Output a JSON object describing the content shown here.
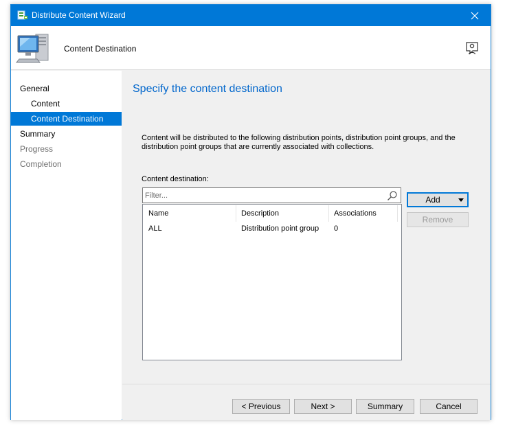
{
  "window": {
    "title": "Distribute Content Wizard",
    "accent_color": "#0078d7"
  },
  "header": {
    "title": "Content Destination",
    "icon": "computer-icon",
    "help_icon": "help-icon"
  },
  "nav": {
    "items": [
      {
        "label": "General",
        "state": "normal"
      },
      {
        "label": "Content",
        "state": "normal"
      },
      {
        "label": "Content Destination",
        "state": "active"
      },
      {
        "label": "Summary",
        "state": "normal"
      },
      {
        "label": "Progress",
        "state": "disabled"
      },
      {
        "label": "Completion",
        "state": "disabled"
      }
    ]
  },
  "main": {
    "heading": "Specify the content destination",
    "description": "Content will be distributed to the following distribution points, distribution point groups, and the distribution point groups that are currently associated with collections.",
    "destination_label": "Content destination:",
    "filter_placeholder": "Filter...",
    "table": {
      "columns": [
        "Name",
        "Description",
        "Associations"
      ],
      "rows": [
        {
          "name": "ALL",
          "description": "Distribution point group",
          "associations": "0"
        }
      ]
    },
    "add_label": "Add",
    "remove_label": "Remove"
  },
  "footer": {
    "previous_label": "< Previous",
    "next_label": "Next >",
    "summary_label": "Summary",
    "cancel_label": "Cancel"
  }
}
